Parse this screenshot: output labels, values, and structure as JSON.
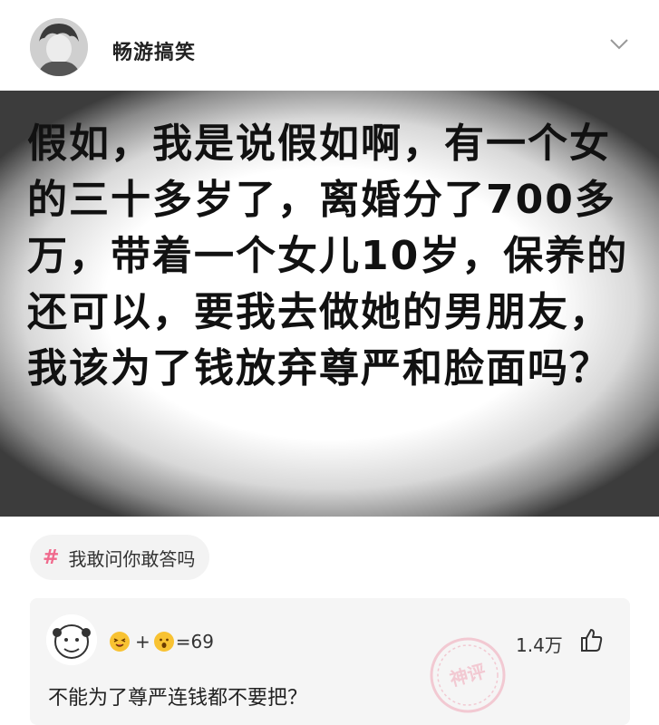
{
  "post": {
    "author": "畅游搞笑",
    "image_text": "假如，我是说假如啊，有一个女的三十多岁了，离婚分了700多万，带着一个女儿10岁，保养的还可以，要我去做她的男朋友，我该为了钱放弃尊严和脸面吗？"
  },
  "topic": {
    "hash": "#",
    "label": "我敢问你敢答吗"
  },
  "comment": {
    "reaction_count": "=69",
    "plus": "+",
    "likes": "1.4万",
    "badge_text": "神评",
    "text": "不能为了尊严连钱都不要把？"
  }
}
